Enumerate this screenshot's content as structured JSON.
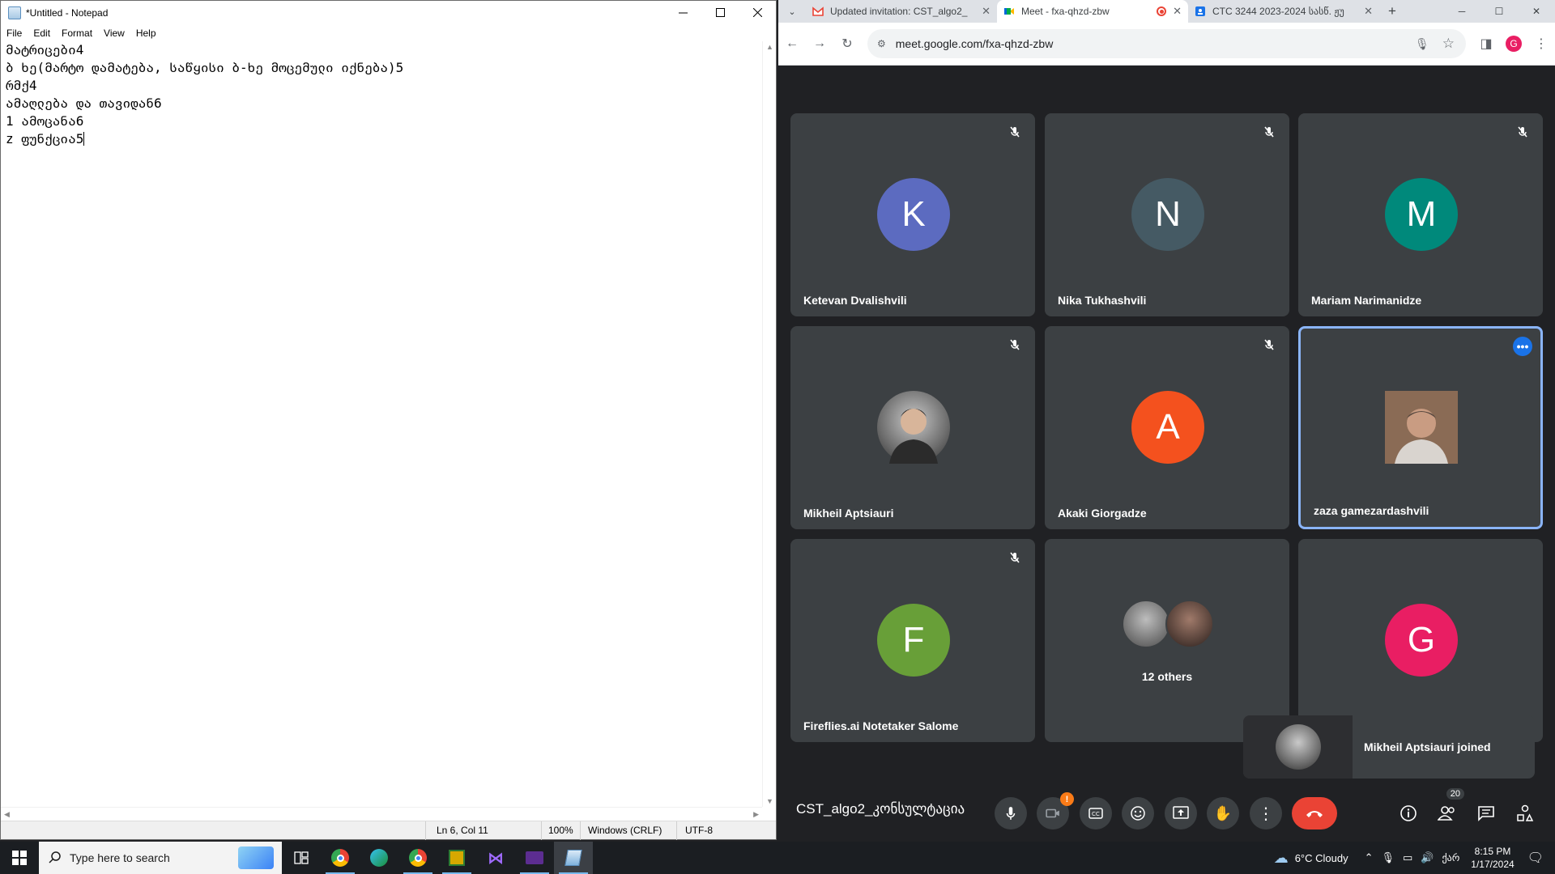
{
  "notepad": {
    "title": "*Untitled - Notepad",
    "menu": [
      "File",
      "Edit",
      "Format",
      "View",
      "Help"
    ],
    "lines": [
      "მატრიცები4",
      "ბ ხე(მარტო დამატება, საწყისი ბ-ხე მოცემული იქნება)5",
      "რმქ4",
      "ამაღლება და თავიდან6",
      "1 ამოცანა6",
      "z ფუნქცია5"
    ],
    "status": {
      "position": "Ln 6, Col 11",
      "zoom": "100%",
      "line_ending": "Windows (CRLF)",
      "encoding": "UTF-8"
    }
  },
  "browser": {
    "tabs": [
      {
        "label": "Updated invitation: CST_algo2_",
        "icon": "gmail-icon",
        "active": false
      },
      {
        "label": "Meet - fxa-qhzd-zbw",
        "icon": "meet-icon",
        "active": true,
        "recording": true
      },
      {
        "label": "CTC 3244 2023-2024 სასწ. ჟუ",
        "icon": "docs-icon",
        "active": false
      }
    ],
    "url": "meet.google.com/fxa-qhzd-zbw",
    "profile_initial": "G",
    "colors": {
      "accent": "#1a73e8",
      "end_call": "#ea4335",
      "tile_bg": "#3c4043"
    }
  },
  "meet": {
    "participants": [
      {
        "name": "Ketevan Dvalishvili",
        "initial": "K",
        "color": "#5c6bc0",
        "muted": true
      },
      {
        "name": "Nika Tukhashvili",
        "initial": "N",
        "color": "#455a64",
        "muted": true
      },
      {
        "name": "Mariam Narimanidze",
        "initial": "M",
        "color": "#00897b",
        "muted": true
      },
      {
        "name": "Mikheil Aptsiauri",
        "initial": "",
        "color": "photo",
        "muted": true
      },
      {
        "name": "Akaki Giorgadze",
        "initial": "A",
        "color": "#f4511e",
        "muted": true
      },
      {
        "name": "zaza gamezardashvili",
        "initial": "",
        "color": "photo",
        "muted": false,
        "highlighted": true
      },
      {
        "name": "Fireflies.ai Notetaker Salome",
        "initial": "F",
        "color": "#689f38",
        "muted": true
      },
      {
        "name": "12 others",
        "initial": "",
        "color": "group",
        "muted": false
      },
      {
        "name": "",
        "initial": "G",
        "color": "#e91e63",
        "muted": false
      }
    ],
    "others_label": "12 others",
    "toast": "Mikheil Aptsiauri joined",
    "meeting_name": "CST_algo2_კონსულტაცია",
    "people_count": "20",
    "camera_warning": "!"
  },
  "taskbar": {
    "search_placeholder": "Type here to search",
    "weather": "6°C  Cloudy",
    "language": "ქარ",
    "time": "8:15 PM",
    "date": "1/17/2024"
  }
}
